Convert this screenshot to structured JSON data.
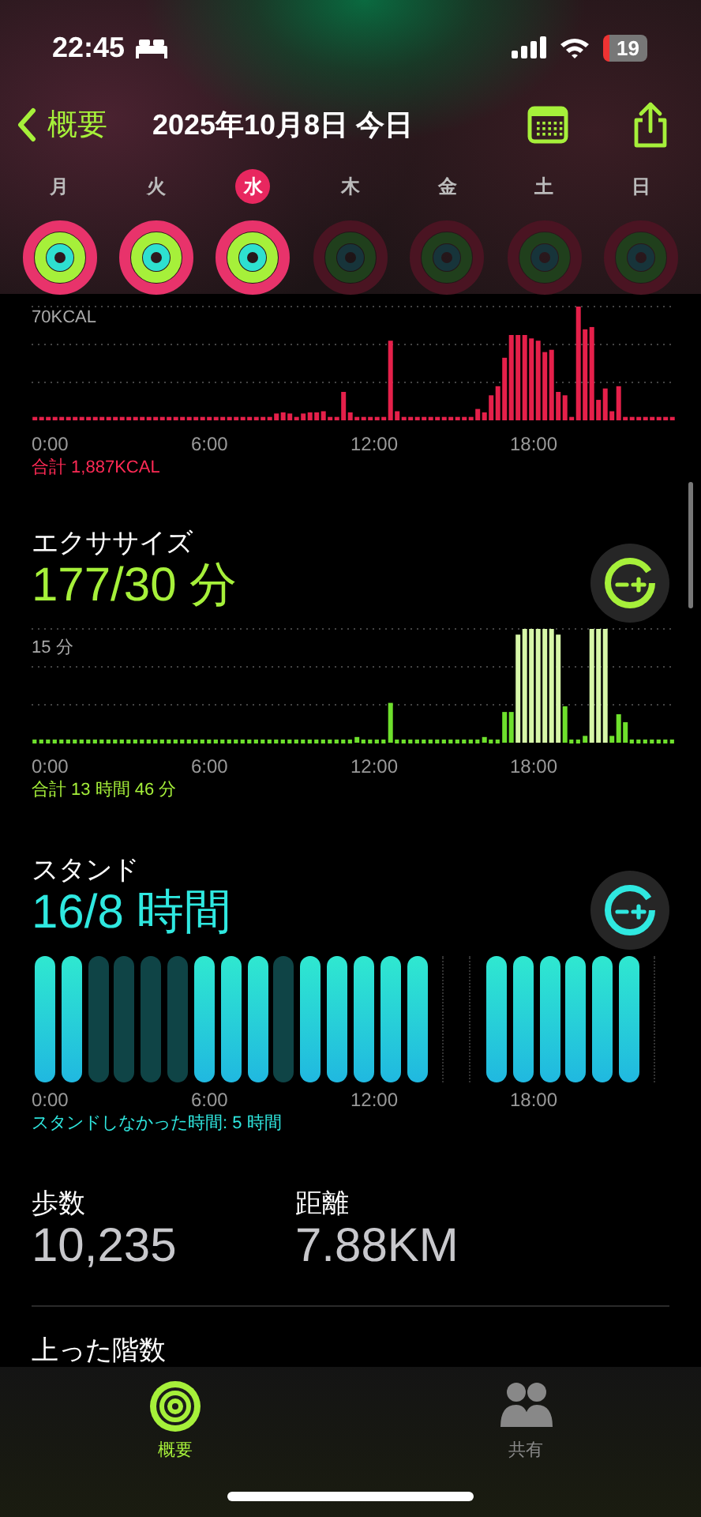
{
  "status_bar": {
    "time": "22:45",
    "battery": "19"
  },
  "nav": {
    "back_label": "概要",
    "title": "2025年10月8日 今日"
  },
  "week": [
    {
      "label": "月",
      "selected": false,
      "dimmed": false
    },
    {
      "label": "火",
      "selected": false,
      "dimmed": false
    },
    {
      "label": "水",
      "selected": true,
      "dimmed": false
    },
    {
      "label": "木",
      "selected": false,
      "dimmed": true
    },
    {
      "label": "金",
      "selected": false,
      "dimmed": true
    },
    {
      "label": "土",
      "selected": false,
      "dimmed": true
    },
    {
      "label": "日",
      "selected": false,
      "dimmed": true
    }
  ],
  "sections": [
    {
      "kind": "move",
      "axis_max": "70KCAL",
      "x_labels": [
        "0:00",
        "6:00",
        "12:00",
        "18:00"
      ],
      "total": "合計 1,887KCAL"
    },
    {
      "kind": "exercise",
      "title": "エクササイズ",
      "value": "177/30 分",
      "axis_max": "15 分",
      "x_labels": [
        "0:00",
        "6:00",
        "12:00",
        "18:00"
      ],
      "total": "合計 13 時間 46 分"
    },
    {
      "kind": "stand",
      "title": "スタンド",
      "value": "16/8 時間",
      "x_labels": [
        "0:00",
        "6:00",
        "12:00",
        "18:00"
      ],
      "total": "スタンドしなかった時間: 5 時間",
      "hours": [
        {
          "kind": "stood"
        },
        {
          "kind": "stood"
        },
        {
          "kind": "missed"
        },
        {
          "kind": "missed"
        },
        {
          "kind": "missed"
        },
        {
          "kind": "missed"
        },
        {
          "kind": "stood"
        },
        {
          "kind": "stood"
        },
        {
          "kind": "stood"
        },
        {
          "kind": "missed"
        },
        {
          "kind": "stood"
        },
        {
          "kind": "stood"
        },
        {
          "kind": "stood"
        },
        {
          "kind": "stood"
        },
        {
          "kind": "stood"
        },
        {
          "kind": "empty"
        },
        {
          "kind": "empty"
        },
        {
          "kind": "stood"
        },
        {
          "kind": "stood"
        },
        {
          "kind": "stood"
        },
        {
          "kind": "stood"
        },
        {
          "kind": "stood"
        },
        {
          "kind": "stood"
        },
        {
          "kind": "empty"
        }
      ]
    }
  ],
  "stats": [
    {
      "label": "歩数",
      "value": "10,235"
    },
    {
      "label": "距離",
      "value": "7.88KM"
    }
  ],
  "floors": {
    "label": "上った階数"
  },
  "tab_bar": [
    {
      "label": "概要",
      "selected": true
    },
    {
      "label": "共有",
      "selected": false
    }
  ]
}
